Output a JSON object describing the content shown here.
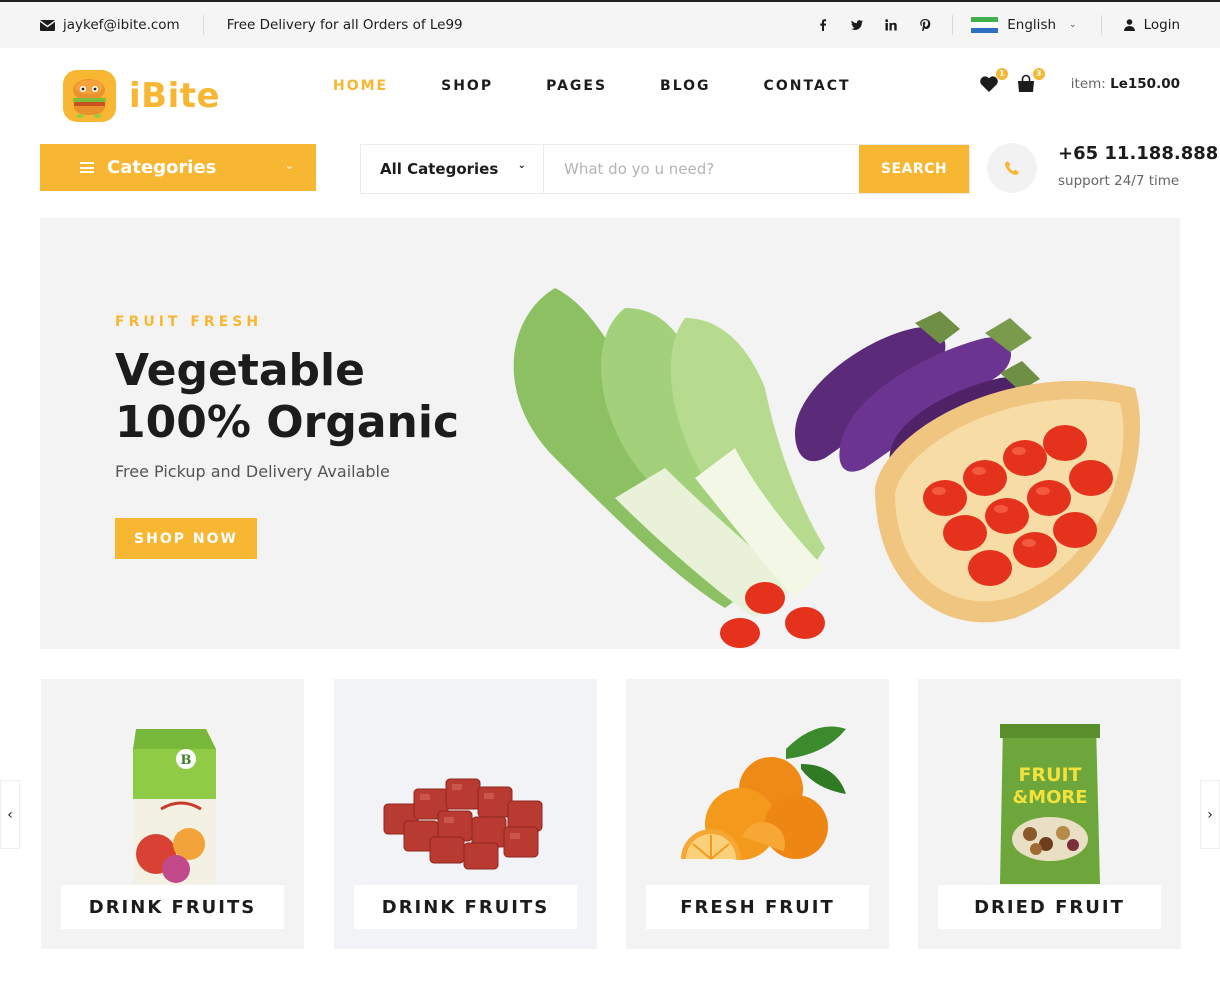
{
  "topbar": {
    "email": "jaykef@ibite.com",
    "delivery_note": "Free Delivery for all Orders of Le99",
    "social_icons": [
      "facebook-icon",
      "twitter-icon",
      "linkedin-icon",
      "pinterest-icon"
    ],
    "language": "English",
    "login_label": "Login"
  },
  "header": {
    "logo_text": "iBite",
    "nav": [
      {
        "label": "HOME",
        "active": true
      },
      {
        "label": "SHOP",
        "active": false
      },
      {
        "label": "PAGES",
        "active": false
      },
      {
        "label": "BLOG",
        "active": false
      },
      {
        "label": "CONTACT",
        "active": false
      }
    ],
    "wishlist_count": "1",
    "cart_count": "3",
    "item_label": "item:",
    "item_total": "Le150.00"
  },
  "search_row": {
    "categories_label": "Categories",
    "select_value": "All Categories",
    "search_placeholder": "What do yo u need?",
    "search_button": "SEARCH",
    "phone_number": "+65 11.188.888",
    "support_text": "support 24/7 time"
  },
  "hero": {
    "kicker": "FRUIT FRESH",
    "title_line1": "Vegetable",
    "title_line2": "100% Organic",
    "description": "Free Pickup and Delivery Available",
    "button_label": "SHOP NOW"
  },
  "categories": [
    {
      "label": "DRINK FRUITS",
      "icon": "juice-carton-image"
    },
    {
      "label": "DRINK FRUITS",
      "icon": "meat-cubes-image"
    },
    {
      "label": "FRESH FRUIT",
      "icon": "oranges-image"
    },
    {
      "label": "DRIED FRUIT",
      "icon": "nuts-bag-image"
    }
  ],
  "colors": {
    "accent": "#f7b733",
    "text": "#1c1c1c",
    "panel": "#f3f3f4"
  }
}
